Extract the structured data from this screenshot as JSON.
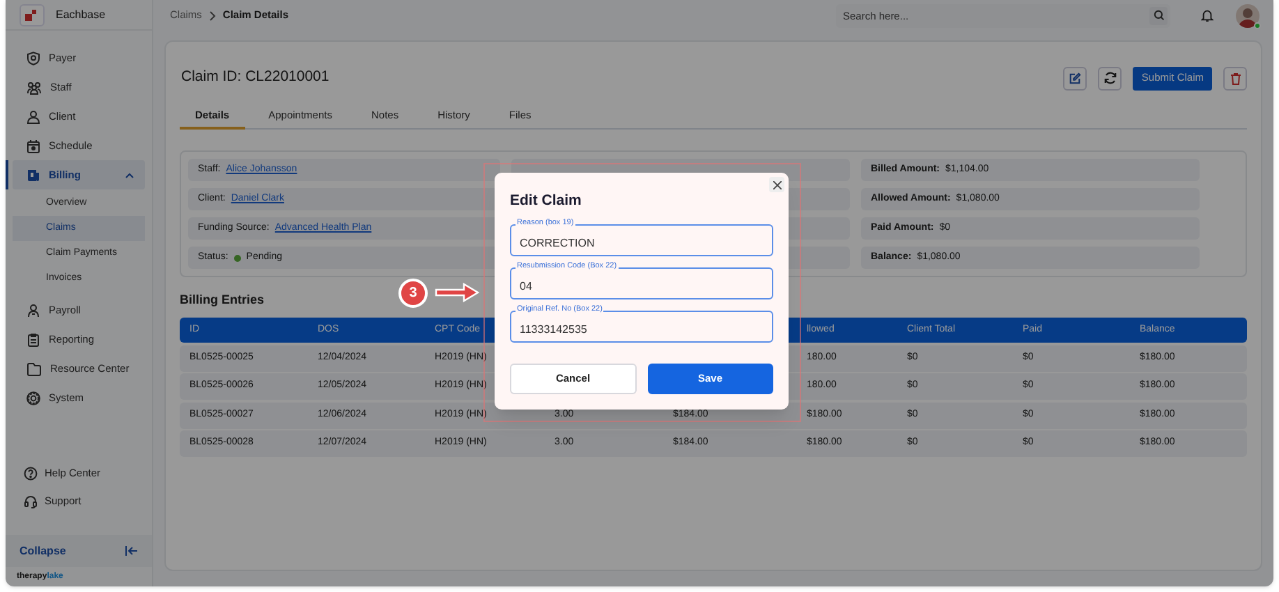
{
  "app": {
    "name": "Eachbase"
  },
  "breadcrumb": [
    {
      "label": "Claims",
      "selected": false
    },
    {
      "label": "Claim Details",
      "selected": true
    }
  ],
  "search": {
    "placeholder": "Search here..."
  },
  "sidebar": {
    "items": [
      {
        "label": "Payer",
        "selected": false
      },
      {
        "label": "Staff",
        "selected": false
      },
      {
        "label": "Client",
        "selected": false
      },
      {
        "label": "Schedule",
        "selected": false
      },
      {
        "label": "Billing",
        "selected": true,
        "expanded": true,
        "children": [
          {
            "label": "Overview",
            "selected": false
          },
          {
            "label": "Claims",
            "selected": true
          },
          {
            "label": "Claim Payments",
            "selected": false
          },
          {
            "label": "Invoices",
            "selected": false
          }
        ]
      },
      {
        "label": "Payroll",
        "selected": false
      },
      {
        "label": "Reporting",
        "selected": false
      },
      {
        "label": "Resource Center",
        "selected": false
      },
      {
        "label": "System",
        "selected": false
      }
    ],
    "footer_items": [
      {
        "label": "Help Center"
      },
      {
        "label": "Support"
      }
    ],
    "collapse": "Collapse",
    "brand": [
      "therapy",
      "lake"
    ]
  },
  "claim": {
    "title": "Claim ID: CL22010001",
    "submit": "Submit Claim"
  },
  "tabs": [
    {
      "label": "Details",
      "selected": true
    },
    {
      "label": "Appointments",
      "selected": false
    },
    {
      "label": "Notes",
      "selected": false
    },
    {
      "label": "History",
      "selected": false
    },
    {
      "label": "Files",
      "selected": false
    }
  ],
  "details": {
    "left": [
      {
        "kind": "link",
        "label": "Staff:",
        "value": "Alice Johansson"
      },
      {
        "kind": "link",
        "label": "Client:",
        "value": "Daniel Clark"
      },
      {
        "kind": "link",
        "label": "Funding Source:",
        "value": "Advanced Health Plan"
      },
      {
        "kind": "status",
        "label": "Status:",
        "value": "Pending"
      }
    ],
    "right": [
      {
        "label": "Billed Amount:",
        "value": "$1,104.00"
      },
      {
        "label": "Allowed Amount:",
        "value": "$1,080.00"
      },
      {
        "label": "Paid Amount:",
        "value": "$0"
      },
      {
        "label": "Balance:",
        "value": "$1,080.00"
      }
    ]
  },
  "billing": {
    "title": "Billing Entries",
    "columns": [
      "ID",
      "DOS",
      "CPT Code",
      null,
      null,
      "llowed",
      "Client Total",
      "Paid",
      "Balance"
    ],
    "rows": [
      [
        "BL0525-00025",
        "12/04/2024",
        "H2019 (HN)",
        null,
        null,
        "180.00",
        "$0",
        "$0",
        "$180.00"
      ],
      [
        "BL0525-00026",
        "12/05/2024",
        "H2019 (HN)",
        null,
        null,
        "180.00",
        "$0",
        "$0",
        "$180.00"
      ],
      [
        "BL0525-00027",
        "12/06/2024",
        "H2019 (HN)",
        "3.00",
        "$184.00",
        "$180.00",
        "$0",
        "$0",
        "$180.00"
      ],
      [
        "BL0525-00028",
        "12/07/2024",
        "H2019 (HN)",
        "3.00",
        "$184.00",
        "$180.00",
        "$0",
        "$0",
        "$180.00"
      ]
    ]
  },
  "modal": {
    "title": "Edit Claim",
    "fields": [
      {
        "label": "Reason (box 19)",
        "value": "CORRECTION"
      },
      {
        "label": "Resubmission Code (Box 22)",
        "value": "04"
      },
      {
        "label": "Original Ref. No (Box 22)",
        "value": "11333142535"
      }
    ],
    "buttons": [
      {
        "label": "Cancel",
        "kind": "secondary"
      },
      {
        "label": "Save",
        "kind": "primary"
      }
    ]
  },
  "annotation": {
    "number": "3"
  }
}
